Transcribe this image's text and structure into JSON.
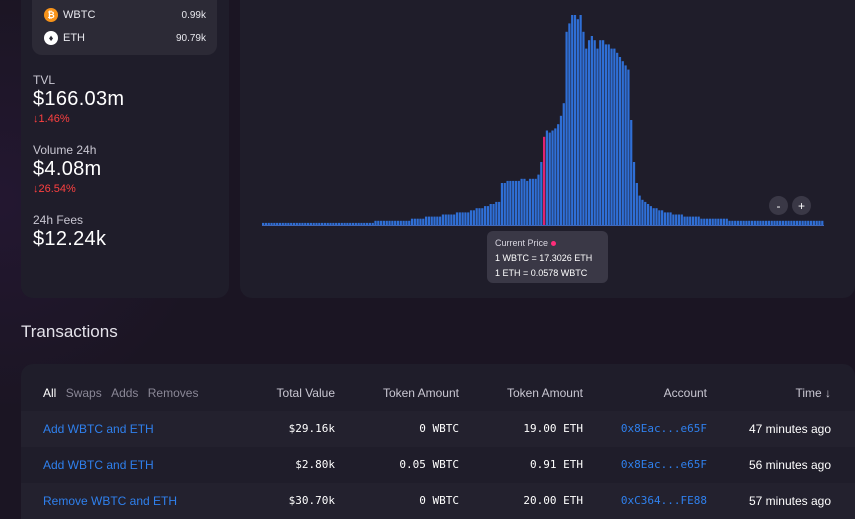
{
  "tokens": [
    {
      "symbol": "WBTC",
      "amount": "0.99k",
      "icon": "wbtc-icon",
      "color": "#f7931a"
    },
    {
      "symbol": "ETH",
      "amount": "90.79k",
      "icon": "eth-icon",
      "color": "#ffffff"
    }
  ],
  "stats": {
    "tvl": {
      "label": "TVL",
      "value": "$166.03m",
      "change": "↓1.46%"
    },
    "volume": {
      "label": "Volume 24h",
      "value": "$4.08m",
      "change": "↓26.54%"
    },
    "fees": {
      "label": "24h Fees",
      "value": "$12.24k"
    }
  },
  "chart": {
    "zoom_out_label": "-",
    "zoom_in_label": "+",
    "bar_color": "#2f6fd6",
    "current_price_color": "#e0216f",
    "tooltip": {
      "title": "Current Price",
      "line1": "1 WBTC = 17.3026 ETH",
      "line2": "1 ETH = 0.0578 WBTC"
    }
  },
  "chart_data": {
    "type": "bar",
    "title": "",
    "xlabel": "",
    "ylabel": "",
    "current_price_index": 100,
    "values": [
      1,
      1,
      1,
      1,
      1,
      1,
      1,
      1,
      1,
      1,
      1,
      1,
      1,
      1,
      1,
      1,
      1,
      1,
      1,
      1,
      1,
      1,
      1,
      1,
      1,
      1,
      1,
      1,
      1,
      1,
      1,
      1,
      1,
      1,
      1,
      1,
      1,
      1,
      1,
      1,
      2,
      2,
      2,
      2,
      2,
      2,
      2,
      2,
      2,
      2,
      2,
      2,
      2,
      3,
      3,
      3,
      3,
      3,
      4,
      4,
      4,
      4,
      4,
      4,
      5,
      5,
      5,
      5,
      5,
      6,
      6,
      6,
      6,
      6,
      7,
      7,
      8,
      8,
      8,
      9,
      9,
      10,
      10,
      11,
      11,
      20,
      20,
      21,
      21,
      21,
      21,
      21,
      22,
      22,
      21,
      22,
      22,
      22,
      24,
      30,
      42,
      45,
      44,
      45,
      46,
      48,
      52,
      58,
      92,
      96,
      100,
      100,
      98,
      100,
      92,
      84,
      88,
      90,
      88,
      84,
      88,
      88,
      86,
      86,
      84,
      84,
      82,
      80,
      78,
      76,
      74,
      50,
      30,
      20,
      14,
      12,
      11,
      10,
      9,
      8,
      8,
      7,
      7,
      6,
      6,
      6,
      5,
      5,
      5,
      5,
      4,
      4,
      4,
      4,
      4,
      4,
      3,
      3,
      3,
      3,
      3,
      3,
      3,
      3,
      3,
      3,
      2,
      2,
      2,
      2,
      2,
      2,
      2,
      2,
      2,
      2,
      2,
      2,
      2,
      2,
      2,
      2,
      2,
      2,
      2,
      2,
      2,
      2,
      2,
      2,
      2,
      2,
      2,
      2,
      2,
      2,
      2,
      2,
      2,
      2
    ]
  },
  "transactions": {
    "heading": "Transactions",
    "filters": [
      "All",
      "Swaps",
      "Adds",
      "Removes"
    ],
    "active_filter": "All",
    "columns": {
      "total_value": "Total Value",
      "token_amount_1": "Token Amount",
      "token_amount_2": "Token Amount",
      "account": "Account",
      "time": "Time ↓"
    },
    "rows": [
      {
        "name": "Add WBTC and ETH",
        "total": "$29.16k",
        "tok1": "0 WBTC",
        "tok2": "19.00 ETH",
        "account": "0x8Eac...e65F",
        "time": "47 minutes ago"
      },
      {
        "name": "Add WBTC and ETH",
        "total": "$2.80k",
        "tok1": "0.05 WBTC",
        "tok2": "0.91 ETH",
        "account": "0x8Eac...e65F",
        "time": "56 minutes ago"
      },
      {
        "name": "Remove WBTC and ETH",
        "total": "$30.70k",
        "tok1": "0 WBTC",
        "tok2": "20.00 ETH",
        "account": "0xC364...FE88",
        "time": "57 minutes ago"
      }
    ]
  }
}
